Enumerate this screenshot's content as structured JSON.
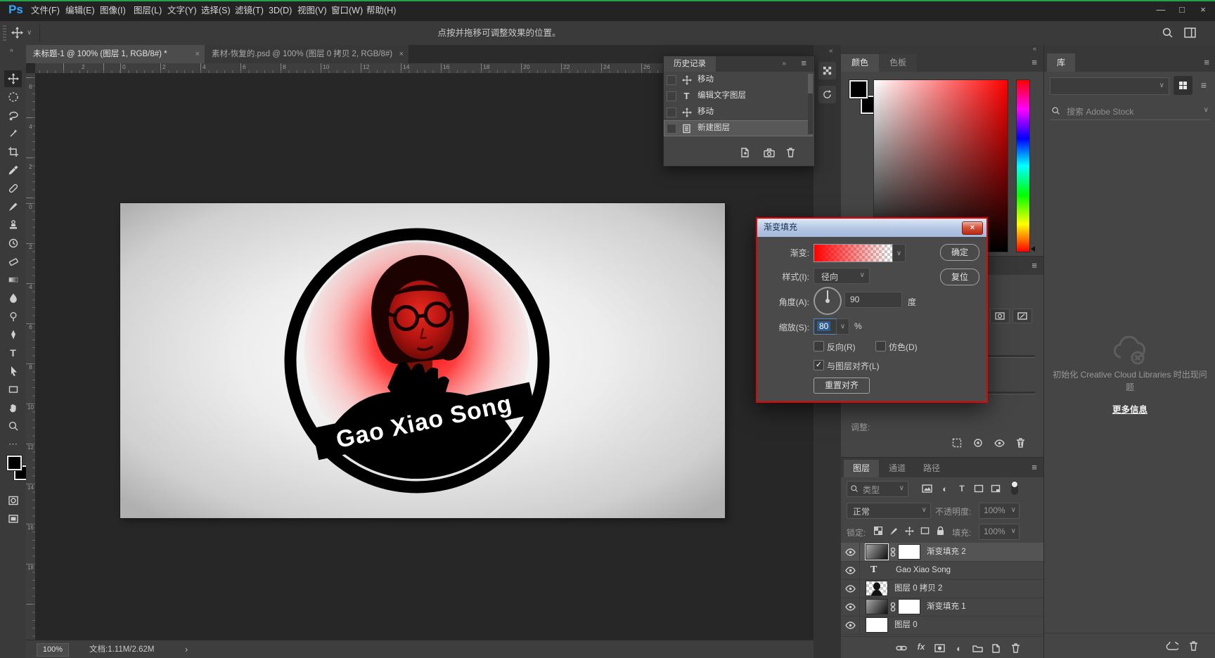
{
  "app": {
    "logo": "Ps",
    "menus": [
      "文件(F)",
      "编辑(E)",
      "图像(I)",
      "图层(L)",
      "文字(Y)",
      "选择(S)",
      "滤镜(T)",
      "3D(D)",
      "视图(V)",
      "窗口(W)",
      "帮助(H)"
    ],
    "options_hint": "点按并拖移可调整效果的位置。"
  },
  "tabs": [
    {
      "title": "未标题-1 @ 100% (图层 1, RGB/8#) *"
    },
    {
      "title": "素材-恢复的.psd @ 100% (图层 0 拷贝 2, RGB/8#)"
    }
  ],
  "ruler_h": [
    "2",
    "0",
    "2",
    "4",
    "6",
    "8",
    "10",
    "12",
    "14",
    "16",
    "18",
    "20",
    "22",
    "24",
    "26"
  ],
  "ruler_v": [
    "6",
    "4",
    "2",
    "0",
    "2",
    "4",
    "6",
    "8",
    "10",
    "12",
    "14",
    "16",
    "18"
  ],
  "canvas": {
    "logo_text": "Gao Xiao Song"
  },
  "history": {
    "title": "历史记录",
    "items": [
      {
        "label": "移动"
      },
      {
        "label": "编辑文字图层"
      },
      {
        "label": "移动"
      },
      {
        "label": "新建图层"
      }
    ]
  },
  "dialog": {
    "title": "渐变填充",
    "gradient_label": "渐变:",
    "style_label": "样式(I):",
    "style_value": "径向",
    "angle_label": "角度(A):",
    "angle_value": "90",
    "angle_unit": "度",
    "scale_label": "缩放(S):",
    "scale_value": "80",
    "scale_unit": "%",
    "reverse_label": "反向(R)",
    "dither_label": "仿色(D)",
    "align_label": "与图层对齐(L)",
    "reset_align_label": "重置对齐",
    "ok_label": "确定",
    "reset_label": "复位"
  },
  "color_panel": {
    "tabs": [
      "颜色",
      "色板"
    ]
  },
  "properties_panel": {
    "adjust_label": "调整:"
  },
  "layers_panel": {
    "tabs": [
      "图层",
      "通道",
      "路径"
    ],
    "filter_type": "类型",
    "blend_mode": "正常",
    "opacity_label": "不透明度:",
    "opacity_value": "100%",
    "lock_label": "锁定:",
    "fill_label": "填充:",
    "fill_value": "100%",
    "layers": [
      {
        "name": "渐变填充 2"
      },
      {
        "name": "Gao Xiao Song"
      },
      {
        "name": "图层 0 拷贝 2"
      },
      {
        "name": "渐变填充 1"
      },
      {
        "name": "图层 0"
      }
    ],
    "fx_label": "fx"
  },
  "libraries_panel": {
    "tab": "库",
    "search_placeholder": "搜索 Adobe Stock",
    "error_text": "初始化 Creative Cloud Libraries 时出现问题",
    "more_info": "更多信息"
  },
  "status_bar": {
    "zoom": "100%",
    "doc_info": "文档:1.11M/2.62M"
  },
  "icons": {
    "close": "×",
    "minimize": "—",
    "maximize": "□",
    "menu": "≡",
    "chevron-down": "∨",
    "collapse-left": "«",
    "expand-right": "»",
    "ellipsis": "⋯",
    "status-arrow": "›",
    "half-circle": "◐",
    "check": "✓",
    "type": "T"
  },
  "accent_colors": {
    "selection_blue": "#2c5d97",
    "dialog_highlight_border": "#e90000",
    "gradient_red": "#ff0000"
  }
}
